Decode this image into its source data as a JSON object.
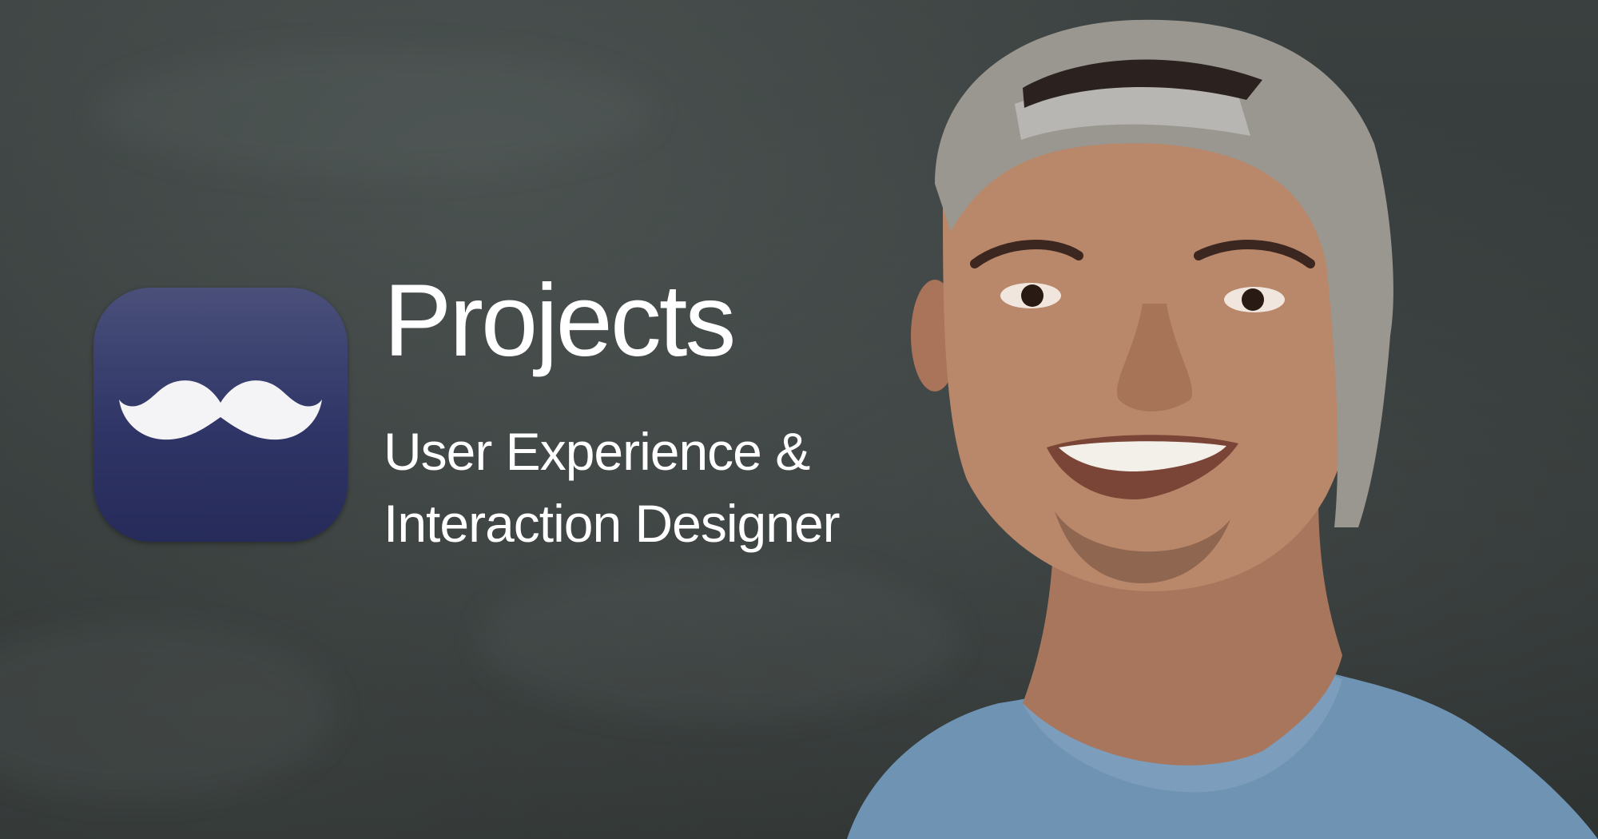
{
  "banner": {
    "title": "Projects",
    "subtitle_line1": "User Experience &",
    "subtitle_line2": "Interaction Designer"
  },
  "app_icon": {
    "icon": "mustache-icon",
    "background_top": "#4a507a",
    "background_bottom": "#262b5a"
  },
  "portrait": {
    "shirt_color": "#6f93b3",
    "cap_color": "#9a9690",
    "skin_color": "#b9876a"
  },
  "colors": {
    "background": "#343a39",
    "text": "#ffffff"
  }
}
